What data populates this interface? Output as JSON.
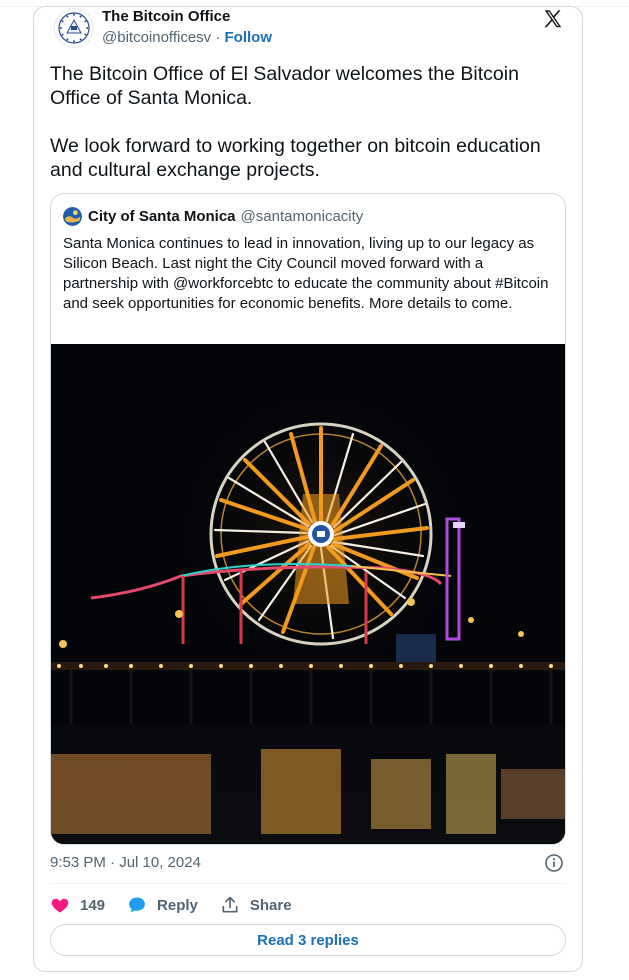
{
  "author": {
    "name": "The Bitcoin Office",
    "handle": "@bitcoinofficesv",
    "separator": "·",
    "follow_label": "Follow"
  },
  "post": {
    "paragraphs": [
      "The Bitcoin Office of El Salvador welcomes the Bitcoin Office of Santa Monica.",
      "We look forward to working together on bitcoin education and cultural exchange projects."
    ]
  },
  "quoted": {
    "name": "City of Santa Monica",
    "handle": "@santamonicacity",
    "text": "Santa Monica continues to lead in innovation, living up to our legacy as Silicon Beach. Last night the City Council moved forward with a partnership with @workforcebtc to educate the community about #Bitcoin and seek opportunities for economic benefits. More details to come.",
    "image_subject": "Santa Monica Pier Ferris wheel lit in orange bitcoin colors at night, reflected in water"
  },
  "meta": {
    "timestamp": "9:53 PM · Jul 10, 2024"
  },
  "actions": {
    "like_count": "149",
    "reply_label": "Reply",
    "share_label": "Share"
  },
  "footer": {
    "read_replies_label": "Read 3 replies"
  },
  "colors": {
    "accent": "#1d6fb8",
    "like": "#f91880",
    "text": "#0f1419",
    "muted": "#536471",
    "border": "#cfd9de"
  },
  "icons": [
    "x-logo-icon",
    "info-icon",
    "heart-icon",
    "reply-bubble-icon",
    "share-icon"
  ]
}
